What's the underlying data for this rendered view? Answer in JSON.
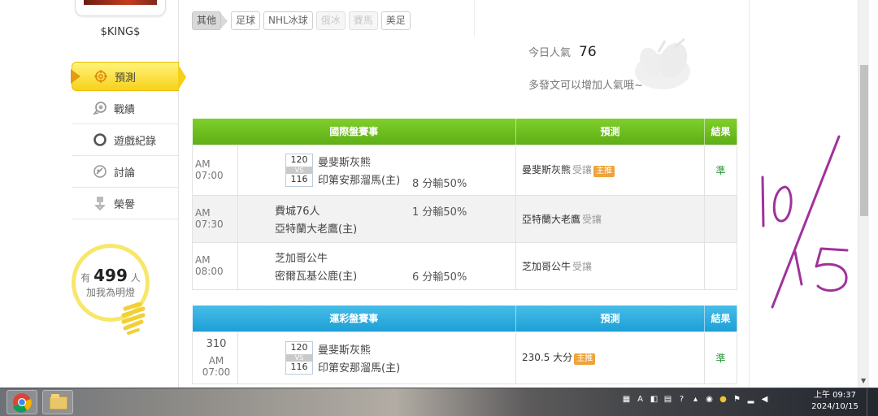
{
  "sidebar": {
    "username": "$KING$",
    "menu": [
      {
        "label": "預測",
        "icon": "target-icon"
      },
      {
        "label": "戰績",
        "icon": "medal-icon"
      },
      {
        "label": "遊戲紀錄",
        "icon": "record-icon"
      },
      {
        "label": "討論",
        "icon": "discuss-icon"
      },
      {
        "label": "榮譽",
        "icon": "trophy-icon"
      }
    ],
    "fans_prefix": "有",
    "fans_count": "499",
    "fans_unit": "人",
    "fans_note": "加我為明燈"
  },
  "filters": {
    "other": "其他",
    "items": [
      "足球",
      "NHL冰球",
      "俄冰",
      "賽馬",
      "美足"
    ]
  },
  "popularity": {
    "label": "今日人氣",
    "value": "76",
    "note": "多發文可以增加人氣哦~"
  },
  "intl": {
    "title": "國際盤賽事",
    "col_pred": "預測",
    "col_result": "結果",
    "rows": [
      {
        "time": "AM 07:00",
        "score_a": "120",
        "vs": "VS",
        "score_b": "116",
        "team_a": "曼斐斯灰熊",
        "team_b": "印第安那溜馬(主)",
        "odds": "8 分輸50%",
        "pred": "曼斐斯灰熊",
        "pred_sub": "受讓",
        "badge": "主推",
        "result": "準"
      },
      {
        "time": "AM 07:30",
        "team_a": "費城76人",
        "team_b": "亞特蘭大老鷹(主)",
        "odds": "1 分輸50%",
        "pred": "亞特蘭大老鷹",
        "pred_sub": "受讓",
        "result": ""
      },
      {
        "time": "AM 08:00",
        "team_a": "芝加哥公牛",
        "team_b": "密爾瓦基公鹿(主)",
        "odds": "6 分輸50%",
        "pred": "芝加哥公牛",
        "pred_sub": "受讓",
        "result": ""
      }
    ]
  },
  "lottery": {
    "title": "運彩盤賽事",
    "col_pred": "預測",
    "col_result": "結果",
    "rows": [
      {
        "game_no": "310",
        "time": "AM 07:00",
        "score_a": "120",
        "vs": "VS",
        "score_b": "116",
        "team_a": "曼斐斯灰熊",
        "team_b": "印第安那溜馬(主)",
        "pred": "230.5 大分",
        "badge": "主推",
        "result": "準"
      }
    ]
  },
  "annotation": {
    "handwritten": "10/15",
    "color": "#a0329c"
  },
  "taskbar": {
    "time": "上午 09:37",
    "date": "2024/10/15",
    "tray_ime": "A"
  }
}
